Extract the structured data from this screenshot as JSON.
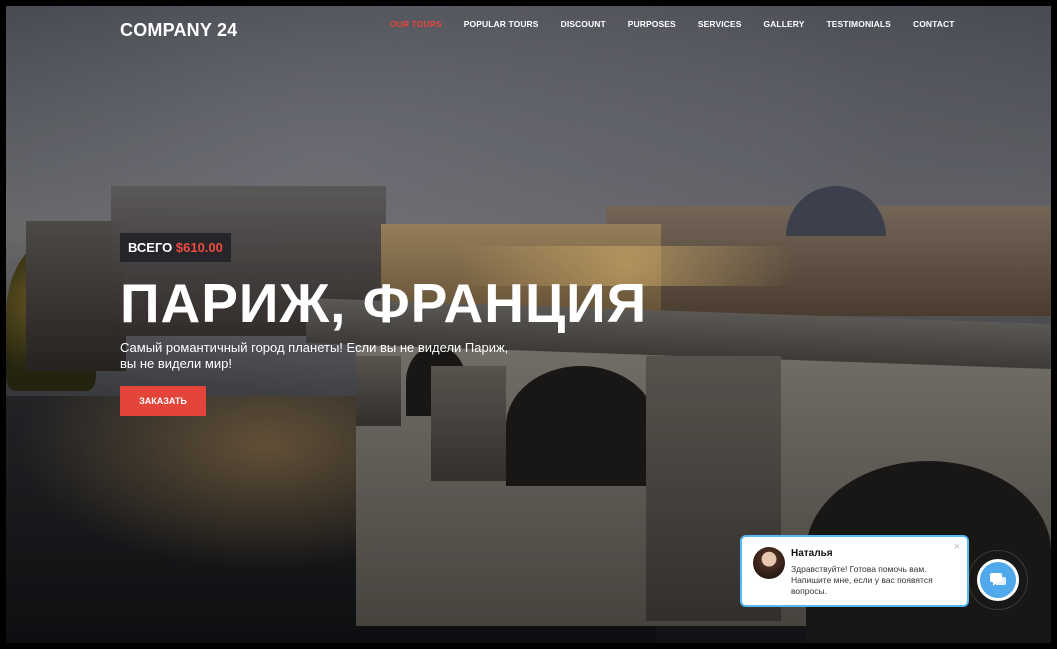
{
  "header": {
    "logo": "COMPANY 24",
    "nav": [
      {
        "label": "OUR TOURS",
        "active": true
      },
      {
        "label": "POPULAR TOURS"
      },
      {
        "label": "DISCOUNT"
      },
      {
        "label": "PURPOSES"
      },
      {
        "label": "SERVICES"
      },
      {
        "label": "GALLERY"
      },
      {
        "label": "TESTIMONIALS"
      },
      {
        "label": "CONTACT"
      }
    ]
  },
  "hero": {
    "price_prefix": "ВСЕГО",
    "price_value": "$610.00",
    "title": "ПАРИЖ, ФРАНЦИЯ",
    "subtitle_line1": "Самый романтичный город планеты! Если вы не видели Париж,",
    "subtitle_line2": "вы не видели мир!",
    "order_button": "ЗАКАЗАТЬ"
  },
  "chat": {
    "agent_name": "Наталья",
    "message": "Здравствуйте! Готова помочь вам. Напишите мне, если у вас появятся вопросы.",
    "close": "×",
    "button_icon": "chat-bubble-icon"
  },
  "colors": {
    "accent": "#e5443a",
    "chat_blue": "#4fa9ea",
    "badge_bg": "#232328"
  }
}
